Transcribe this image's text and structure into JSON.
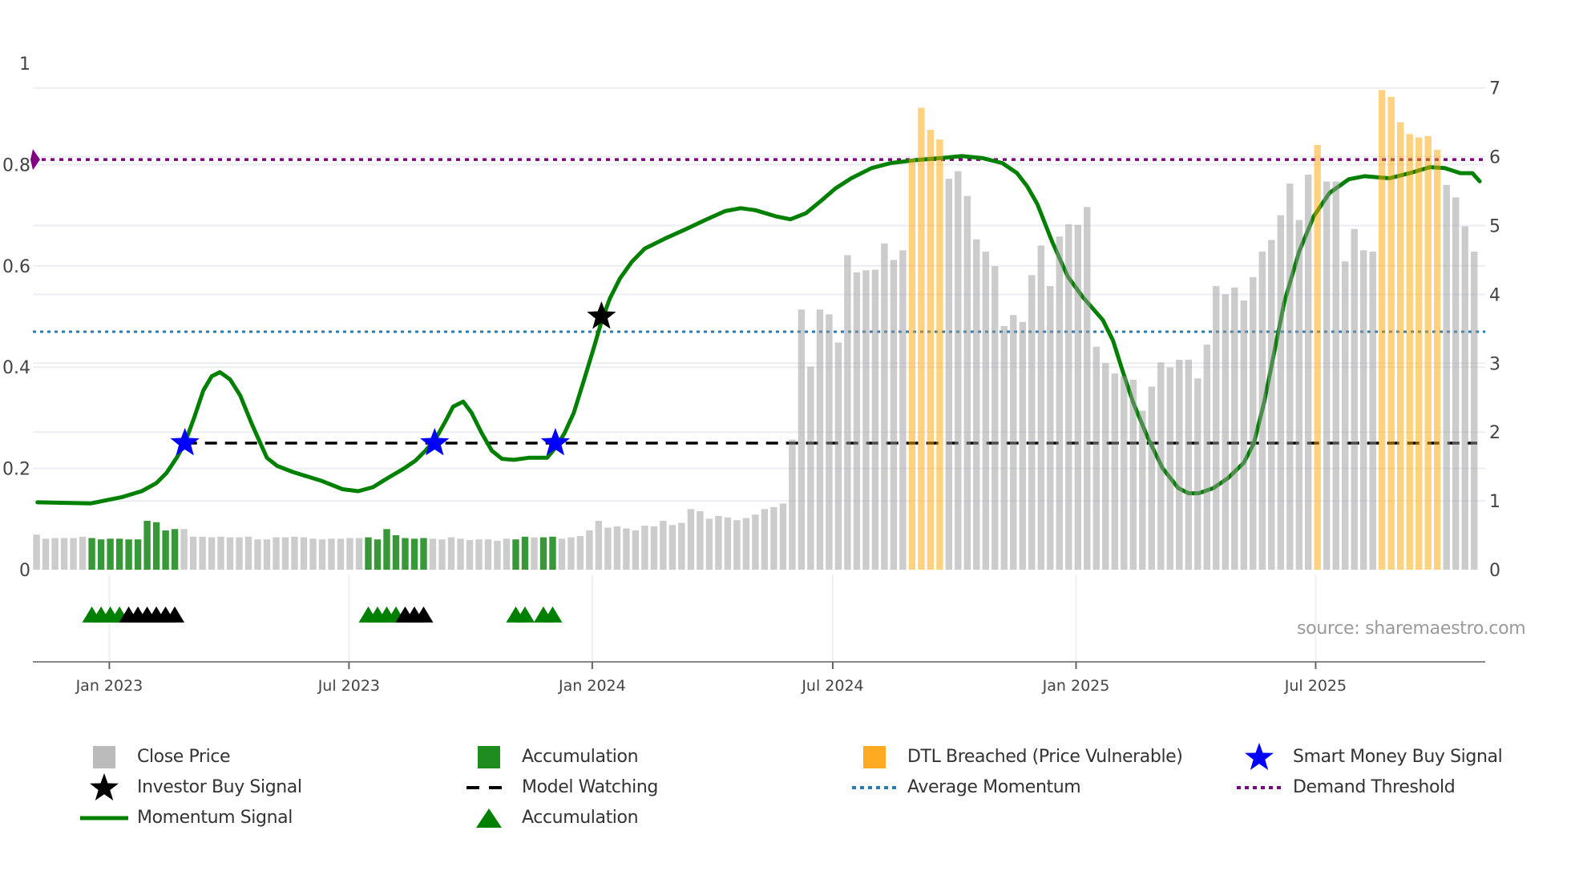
{
  "chart_data": {
    "type": "bar",
    "title": "",
    "x_unit": "week index (weekly bars, Nov 2022 - Nov 2025)",
    "x_range": [
      0.6,
      158.2
    ],
    "x_ticks": [
      {
        "label": "Jan 2023",
        "week": 8.9
      },
      {
        "label": "Jul 2023",
        "week": 34.9
      },
      {
        "label": "Jan 2024",
        "week": 61.3
      },
      {
        "label": "Jul 2024",
        "week": 87.4
      },
      {
        "label": "Jan 2025",
        "week": 113.8
      },
      {
        "label": "Jul 2025",
        "week": 139.8
      }
    ],
    "left_axis": {
      "range": [
        0,
        1
      ],
      "ticks": [
        "0",
        "0.2",
        "0.4",
        "0.6",
        "0.8",
        "1"
      ],
      "tick_values": [
        0,
        0.2,
        0.4,
        0.6,
        0.8,
        1
      ]
    },
    "right_axis": {
      "range": [
        0,
        7
      ],
      "ticks": [
        "0",
        "1",
        "2",
        "3",
        "4",
        "5",
        "6",
        "7"
      ],
      "tick_values": [
        0,
        1,
        2,
        3,
        4,
        5,
        6,
        7
      ]
    },
    "close_price": [
      0.51,
      0.45,
      0.46,
      0.46,
      0.46,
      0.48,
      0.46,
      0.44,
      0.45,
      0.45,
      0.44,
      0.44,
      0.71,
      0.69,
      0.57,
      0.59,
      0.59,
      0.48,
      0.48,
      0.47,
      0.48,
      0.47,
      0.47,
      0.48,
      0.44,
      0.44,
      0.47,
      0.47,
      0.48,
      0.47,
      0.45,
      0.44,
      0.45,
      0.45,
      0.46,
      0.46,
      0.47,
      0.44,
      0.59,
      0.5,
      0.46,
      0.45,
      0.46,
      0.45,
      0.44,
      0.47,
      0.45,
      0.43,
      0.44,
      0.44,
      0.42,
      0.45,
      0.44,
      0.48,
      0.47,
      0.47,
      0.48,
      0.45,
      0.47,
      0.49,
      0.57,
      0.71,
      0.61,
      0.63,
      0.6,
      0.57,
      0.64,
      0.63,
      0.71,
      0.65,
      0.68,
      0.88,
      0.85,
      0.74,
      0.78,
      0.76,
      0.72,
      0.75,
      0.8,
      0.88,
      0.91,
      0.96,
      1.89,
      3.78,
      2.95,
      3.78,
      3.71,
      3.3,
      4.57,
      4.32,
      4.35,
      4.36,
      4.74,
      4.5,
      4.64,
      5.97,
      6.71,
      6.39,
      6.25,
      5.68,
      5.79,
      5.43,
      4.8,
      4.62,
      4.41,
      3.54,
      3.7,
      3.6,
      4.28,
      4.71,
      4.12,
      4.84,
      5.02,
      5.01,
      5.27,
      3.24,
      3.0,
      2.85,
      2.81,
      2.76,
      2.31,
      2.66,
      3.01,
      2.94,
      3.05,
      3.05,
      2.78,
      3.27,
      4.12,
      4.0,
      4.1,
      3.91,
      4.25,
      4.62,
      4.79,
      5.15,
      5.61,
      5.08,
      5.74,
      6.17,
      5.64,
      5.64,
      4.48,
      4.95,
      4.64,
      4.62,
      6.97,
      6.87,
      6.5,
      6.33,
      6.28,
      6.3,
      6.1,
      5.59,
      5.41,
      4.99,
      4.62
    ],
    "accumulation_bars": [
      [
        7,
        16
      ],
      [
        37,
        43
      ],
      [
        53,
        54
      ],
      [
        56,
        57
      ]
    ],
    "dtl_breached_bars": [
      [
        96,
        99
      ],
      [
        140,
        140
      ],
      [
        147,
        153
      ]
    ],
    "momentum_signal": [
      [
        1.1,
        0.133
      ],
      [
        6.9,
        0.131
      ],
      [
        10.2,
        0.143
      ],
      [
        12.4,
        0.155
      ],
      [
        14.0,
        0.171
      ],
      [
        15.1,
        0.191
      ],
      [
        16.2,
        0.221
      ],
      [
        17.1,
        0.25
      ],
      [
        18.1,
        0.3
      ],
      [
        19.1,
        0.354
      ],
      [
        20.0,
        0.382
      ],
      [
        20.9,
        0.39
      ],
      [
        22.0,
        0.376
      ],
      [
        23.1,
        0.344
      ],
      [
        24.4,
        0.286
      ],
      [
        26.0,
        0.221
      ],
      [
        27.1,
        0.205
      ],
      [
        28.8,
        0.193
      ],
      [
        32.0,
        0.175
      ],
      [
        34.2,
        0.159
      ],
      [
        35.9,
        0.155
      ],
      [
        37.5,
        0.163
      ],
      [
        39.1,
        0.181
      ],
      [
        40.8,
        0.199
      ],
      [
        42.1,
        0.215
      ],
      [
        43.2,
        0.235
      ],
      [
        44.3,
        0.258
      ],
      [
        45.4,
        0.294
      ],
      [
        46.2,
        0.322
      ],
      [
        47.3,
        0.332
      ],
      [
        48.2,
        0.31
      ],
      [
        49.3,
        0.27
      ],
      [
        50.4,
        0.235
      ],
      [
        51.5,
        0.219
      ],
      [
        52.8,
        0.217
      ],
      [
        54.4,
        0.221
      ],
      [
        56.4,
        0.221
      ],
      [
        57.4,
        0.243
      ],
      [
        58.3,
        0.27
      ],
      [
        59.3,
        0.31
      ],
      [
        60.4,
        0.374
      ],
      [
        61.5,
        0.44
      ],
      [
        62.3,
        0.49
      ],
      [
        63.2,
        0.535
      ],
      [
        64.3,
        0.575
      ],
      [
        65.6,
        0.608
      ],
      [
        67.0,
        0.634
      ],
      [
        69.2,
        0.654
      ],
      [
        71.4,
        0.672
      ],
      [
        73.5,
        0.69
      ],
      [
        75.7,
        0.708
      ],
      [
        77.4,
        0.714
      ],
      [
        79.0,
        0.71
      ],
      [
        81.2,
        0.698
      ],
      [
        82.8,
        0.692
      ],
      [
        84.5,
        0.704
      ],
      [
        86.1,
        0.728
      ],
      [
        87.7,
        0.753
      ],
      [
        89.4,
        0.773
      ],
      [
        91.6,
        0.793
      ],
      [
        93.7,
        0.803
      ],
      [
        96.5,
        0.809
      ],
      [
        99.2,
        0.813
      ],
      [
        101.4,
        0.817
      ],
      [
        103.6,
        0.813
      ],
      [
        105.8,
        0.803
      ],
      [
        107.4,
        0.783
      ],
      [
        108.5,
        0.757
      ],
      [
        109.6,
        0.722
      ],
      [
        111.2,
        0.648
      ],
      [
        112.9,
        0.579
      ],
      [
        114.5,
        0.539
      ],
      [
        116.7,
        0.493
      ],
      [
        117.8,
        0.453
      ],
      [
        118.9,
        0.39
      ],
      [
        120.0,
        0.33
      ],
      [
        121.6,
        0.26
      ],
      [
        123.2,
        0.2
      ],
      [
        124.9,
        0.161
      ],
      [
        126.0,
        0.151
      ],
      [
        127.1,
        0.151
      ],
      [
        128.7,
        0.161
      ],
      [
        130.3,
        0.181
      ],
      [
        132.0,
        0.211
      ],
      [
        133.1,
        0.25
      ],
      [
        134.2,
        0.33
      ],
      [
        135.3,
        0.429
      ],
      [
        136.4,
        0.529
      ],
      [
        138.0,
        0.628
      ],
      [
        139.6,
        0.698
      ],
      [
        141.3,
        0.744
      ],
      [
        143.4,
        0.771
      ],
      [
        145.1,
        0.777
      ],
      [
        147.8,
        0.773
      ],
      [
        150.0,
        0.783
      ],
      [
        152.2,
        0.795
      ],
      [
        153.8,
        0.793
      ],
      [
        155.5,
        0.783
      ],
      [
        156.8,
        0.783
      ],
      [
        157.6,
        0.767
      ]
    ],
    "demand_threshold": 0.81,
    "average_momentum": 0.47,
    "model_watching": {
      "value": 0.25,
      "from_week": 17.1
    },
    "smart_money_buy_signals": [
      [
        17.1,
        0.25
      ],
      [
        44.2,
        0.25
      ],
      [
        57.3,
        0.25
      ]
    ],
    "investor_buy_signals": [
      [
        62.3,
        0.5
      ]
    ],
    "accumulation_markers": [
      7,
      8,
      9,
      10,
      37,
      38,
      39,
      40,
      53,
      54,
      56,
      57
    ],
    "investor_markers": [
      11,
      12,
      13,
      14,
      15,
      16,
      41,
      42,
      43
    ],
    "marker_row_value": -0.09,
    "legend_placement": "bottom",
    "grid": true
  },
  "colors": {
    "close_price": "#999999",
    "accumulation": "#1a8a1a",
    "dtl_breached": "#FFA500",
    "momentum": "#008000",
    "smart_money": "#0000FF",
    "investor": "#000000",
    "average_momentum": "#2c7bb0",
    "demand_threshold": "#800080",
    "model_watching": "#000000"
  },
  "legend": {
    "close_price": "Close Price",
    "accumulation_bar": "Accumulation",
    "dtl_breached": "DTL Breached (Price Vulnerable)",
    "smart_money": "Smart Money Buy Signal",
    "investor_buy": "Investor Buy Signal",
    "model_watching": "Model Watching",
    "average_momentum": "Average Momentum",
    "demand_threshold": "Demand Threshold",
    "momentum_signal": "Momentum Signal",
    "accumulation_marker": "Accumulation"
  },
  "source": "source: sharemaestro.com"
}
